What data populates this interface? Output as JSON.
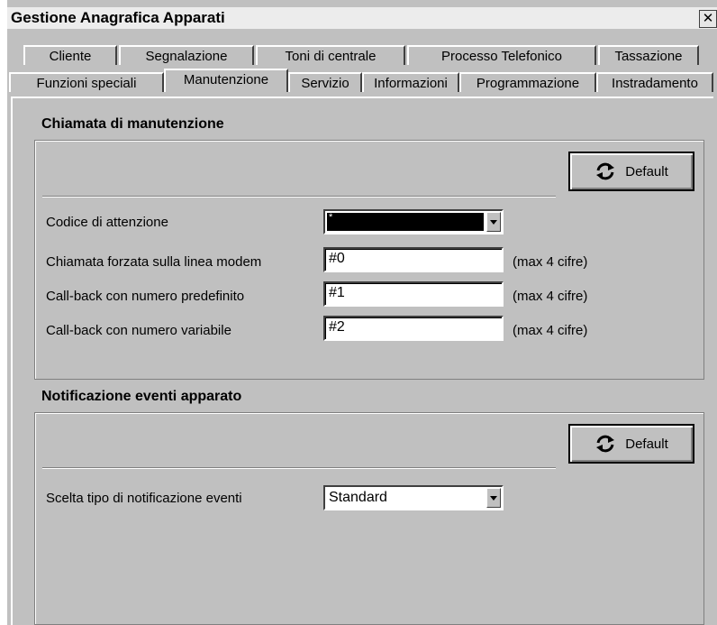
{
  "window": {
    "title": "Gestione Anagrafica Apparati",
    "close_glyph": "✕"
  },
  "tabs": {
    "row1": [
      "Cliente",
      "Segnalazione",
      "Toni di centrale",
      "Processo Telefonico",
      "Tassazione"
    ],
    "row2": [
      "Funzioni speciali",
      "Manutenzione",
      "Servizio",
      "Informazioni",
      "Programmazione",
      "Instradamento"
    ],
    "active": "Manutenzione"
  },
  "section1": {
    "title": "Chiamata di manutenzione",
    "default_label": "Default",
    "rows": [
      {
        "label": "Codice di attenzione",
        "value": "*",
        "type": "select"
      },
      {
        "label": "Chiamata forzata sulla linea modem",
        "value": "#0",
        "hint": "(max 4 cifre)"
      },
      {
        "label": "Call-back con numero predefinito",
        "value": "#1",
        "hint": "(max 4 cifre)"
      },
      {
        "label": "Call-back con numero variabile",
        "value": "#2",
        "hint": "(max 4 cifre)"
      }
    ]
  },
  "section2": {
    "title": "Notificazione eventi apparato",
    "default_label": "Default",
    "rows": [
      {
        "label": "Scelta tipo di notificazione eventi",
        "value": "Standard",
        "type": "select"
      }
    ]
  },
  "icons": {
    "default_button": "refresh-icon"
  }
}
